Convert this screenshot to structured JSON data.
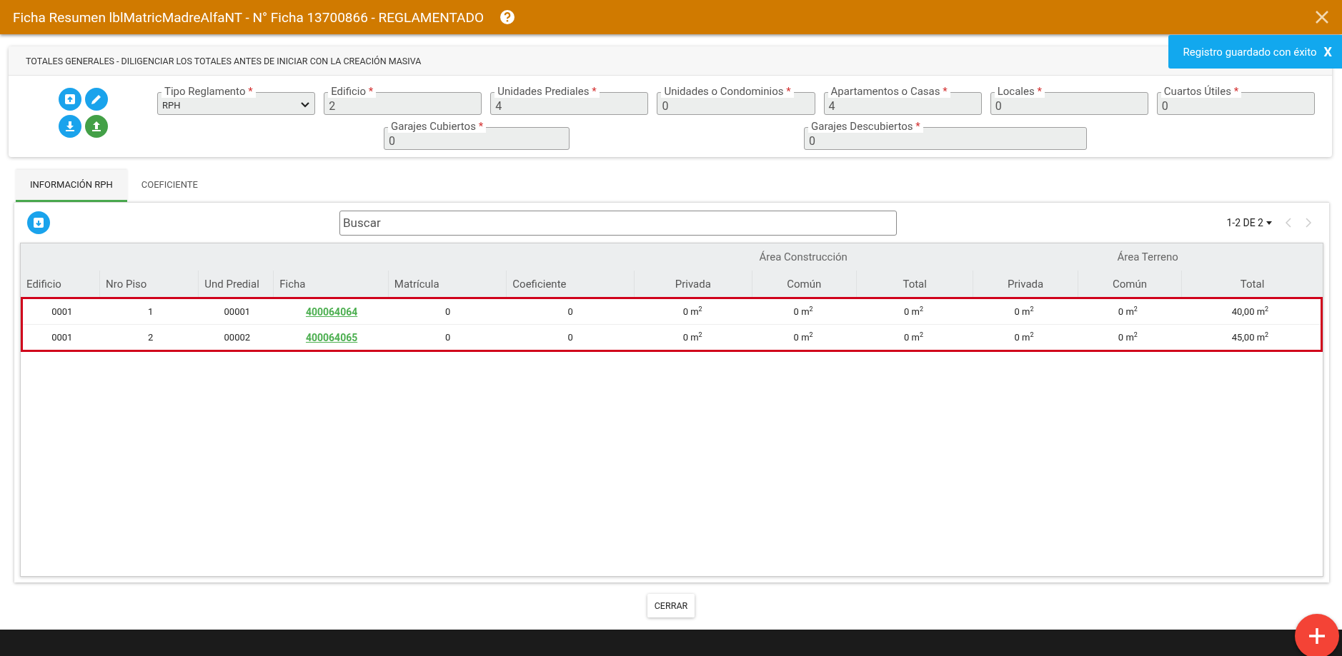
{
  "window": {
    "title": "Ficha Resumen lblMatricMadreAlfaNT - N° Ficha 13700866 - REGLAMENTADO"
  },
  "toast": {
    "message": "Registro guardado con éxito",
    "close": "X"
  },
  "totals": {
    "title": "TOTALES GENERALES - DILIGENCIAR LOS TOTALES ANTES DE INICIAR CON LA CREACIÓN MASIVA",
    "fields": [
      {
        "label": "Tipo Reglamento",
        "mark": "*",
        "value": "RPH",
        "kind": "select"
      },
      {
        "label": "Edificio",
        "mark": "*",
        "value": "2",
        "kind": "input"
      },
      {
        "label": "Unidades Prediales",
        "mark": "*",
        "value": "4",
        "kind": "input"
      },
      {
        "label": "Unidades o Condominios",
        "mark": "*",
        "value": "0",
        "kind": "input"
      },
      {
        "label": "Apartamentos o Casas",
        "mark": "*",
        "value": "4",
        "kind": "input"
      },
      {
        "label": "Locales",
        "mark": "*",
        "value": "0",
        "kind": "input"
      },
      {
        "label": "Cuartos Útiles",
        "mark": "*",
        "value": "0",
        "kind": "input"
      }
    ],
    "fields_row_2": [
      {
        "label": "Garajes Cubiertos",
        "mark": "*",
        "value": "0"
      },
      {
        "label": "Garajes Descubiertos",
        "mark": "*",
        "value": "0"
      }
    ]
  },
  "tabs": [
    {
      "label": "INFORMACIÓN RPH",
      "selected": true
    },
    {
      "label": "COEFICIENTE",
      "selected": false
    }
  ],
  "search": {
    "placeholder": "Buscar"
  },
  "pagination": {
    "label": "1-2 DE 2"
  },
  "table": {
    "highlight": true,
    "columns": [
      {
        "label": "Edificio",
        "kind": "text"
      },
      {
        "label": "Nro Piso",
        "kind": "text"
      },
      {
        "label": "Und Predial",
        "kind": "text"
      },
      {
        "label": "Ficha",
        "kind": "link"
      },
      {
        "label": "Matrícula",
        "kind": "text"
      },
      {
        "label": "Coeficiente",
        "kind": "text"
      }
    ],
    "groups": [
      {
        "label": "Área Construcción",
        "columns": [
          {
            "label": "Privada"
          },
          {
            "label": "Común"
          },
          {
            "label": "Total"
          }
        ]
      },
      {
        "label": "Área Terreno",
        "columns": [
          {
            "label": "Privada"
          },
          {
            "label": "Común"
          },
          {
            "label": "Total"
          }
        ]
      }
    ],
    "rows": [
      {
        "cells": [
          "0001",
          "1",
          "00001",
          "400064064",
          "0",
          "0",
          "0 m$^{2}$",
          "0 m$^{2}$",
          "0 m$^{2}$",
          "0 m$^{2}$",
          "0 m$^{2}$",
          "40,00 m$^{2}$"
        ]
      },
      {
        "cells": [
          "0001",
          "2",
          "00002",
          "400064065",
          "0",
          "0",
          "0 m$^{2}$",
          "0 m$^{2}$",
          "0 m$^{2}$",
          "0 m$^{2}$",
          "0 m$^{2}$",
          "45,00 m$^{2}$"
        ]
      }
    ]
  },
  "buttons": [
    "CERRAR"
  ]
}
